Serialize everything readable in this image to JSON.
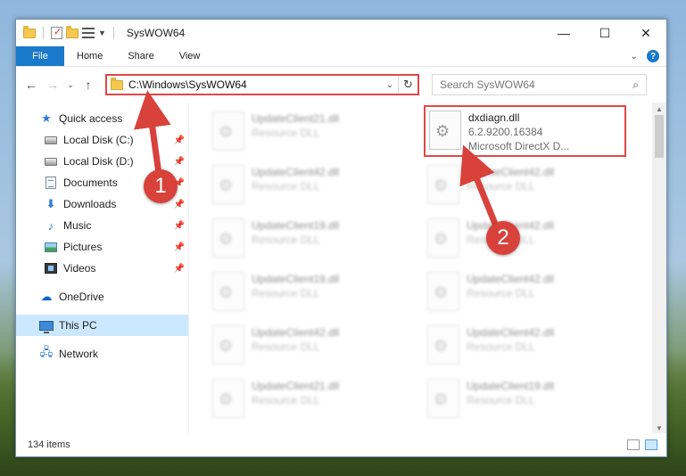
{
  "window": {
    "title": "SysWOW64",
    "controls": {
      "minimize": "—",
      "maximize": "☐",
      "close": "✕"
    }
  },
  "ribbon": {
    "tabs": [
      "File",
      "Home",
      "Share",
      "View"
    ],
    "expand_icon": "chevron-down-icon",
    "help": "?"
  },
  "navigation": {
    "back": "←",
    "forward": "→",
    "recent": "⌄",
    "up": "↑",
    "address": "C:\\Windows\\SysWOW64",
    "search_placeholder": "Search SysWOW64"
  },
  "sidebar": {
    "items": [
      {
        "label": "Quick access",
        "icon": "star-icon",
        "pinned": false
      },
      {
        "label": "Local Disk (C:)",
        "icon": "disk-icon",
        "pinned": true
      },
      {
        "label": "Local Disk (D:)",
        "icon": "disk-icon",
        "pinned": true
      },
      {
        "label": "Documents",
        "icon": "document-icon",
        "pinned": true
      },
      {
        "label": "Downloads",
        "icon": "download-icon",
        "pinned": true
      },
      {
        "label": "Music",
        "icon": "music-icon",
        "pinned": true
      },
      {
        "label": "Pictures",
        "icon": "picture-icon",
        "pinned": true
      },
      {
        "label": "Videos",
        "icon": "video-icon",
        "pinned": true
      },
      {
        "label": "OneDrive",
        "icon": "cloud-icon",
        "pinned": false
      },
      {
        "label": "This PC",
        "icon": "computer-icon",
        "pinned": false,
        "selected": true
      },
      {
        "label": "Network",
        "icon": "network-icon",
        "pinned": false
      }
    ]
  },
  "files": {
    "left_column": [
      {
        "name": "UpdateClient21.dll",
        "type": "Resource DLL"
      },
      {
        "name": "UpdateClient42.dll",
        "type": "Resource DLL"
      },
      {
        "name": "UpdateClient19.dll",
        "type": "Resource DLL"
      },
      {
        "name": "UpdateClient19.dll",
        "type": "Resource DLL"
      },
      {
        "name": "UpdateClient42.dll",
        "type": "Resource DLL"
      },
      {
        "name": "UpdateClient21.dll",
        "type": "Resource DLL"
      }
    ],
    "right_column": [
      {
        "name": "dxdiagn.dll",
        "version": "6.2.9200.16384",
        "description": "Microsoft DirectX D...",
        "highlighted": true
      },
      {
        "name": "UpdateClient42.dll",
        "type": "Resource DLL"
      },
      {
        "name": "UpdateClient42.dll",
        "type": "Resource DLL"
      },
      {
        "name": "UpdateClient42.dll",
        "type": "Resource DLL"
      },
      {
        "name": "UpdateClient42.dll",
        "type": "Resource DLL"
      },
      {
        "name": "UpdateClient19.dll",
        "type": "Resource DLL"
      }
    ]
  },
  "status": {
    "item_count": "134 items"
  },
  "callouts": {
    "one": "1",
    "two": "2"
  },
  "colors": {
    "accent": "#1979ca",
    "highlight_border": "#e04848",
    "selected_bg": "#cce8ff",
    "callout": "#d9413b"
  }
}
